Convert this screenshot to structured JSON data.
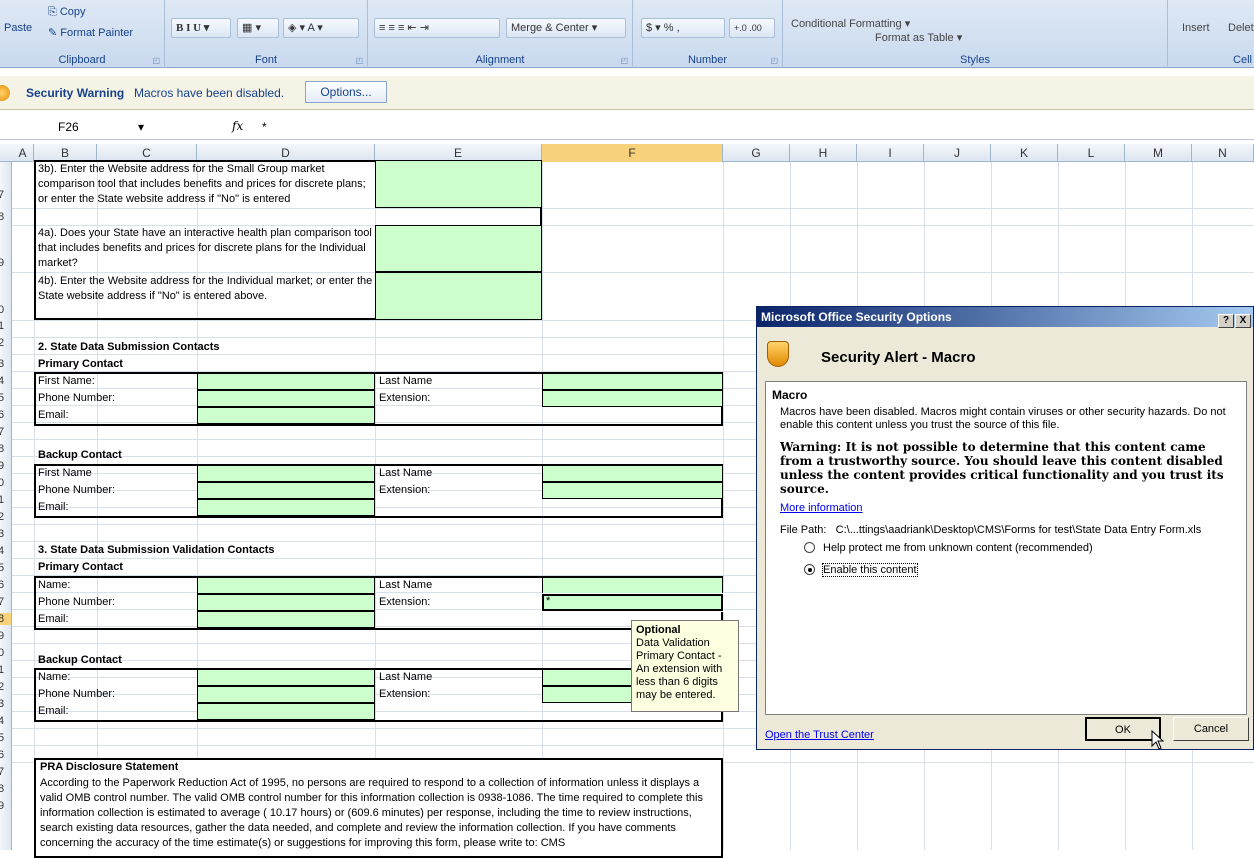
{
  "ribbon": {
    "clipboard": {
      "paste": "Paste",
      "copy": "Copy",
      "format_painter": "Format Painter",
      "label": "Clipboard"
    },
    "font_label": "Font",
    "alignment": {
      "merge_center": "Merge & Center",
      "label": "Alignment"
    },
    "number": {
      "label": "Number",
      "currency": "$",
      "percent": "%",
      "comma": ","
    },
    "styles": {
      "conditional": "Conditional Formatting",
      "format_table": "Format as Table",
      "label": "Styles"
    },
    "cells": {
      "insert": "Insert",
      "delete": "Delet",
      "label": "Cell"
    }
  },
  "security_bar": {
    "title": "Security Warning",
    "message": "Macros have been disabled.",
    "options": "Options..."
  },
  "formula_bar": {
    "name_box": "F26",
    "fx": "fx",
    "value": "*"
  },
  "columns": [
    "A",
    "B",
    "C",
    "D",
    "E",
    "F",
    "G",
    "H",
    "I",
    "J",
    "K",
    "L",
    "M",
    "N"
  ],
  "row_numbers": [
    "7",
    "8",
    "9",
    "0",
    "1",
    "2",
    "3",
    "4",
    "5",
    "6",
    "7",
    "8",
    "9",
    "0",
    "1",
    "2",
    "3",
    "4",
    "5",
    "6",
    "7",
    "8",
    "9",
    "0",
    "1",
    "2",
    "3",
    "4",
    "5",
    "6",
    "7",
    "8",
    "9"
  ],
  "sheet": {
    "q3b": "3b). Enter the Website address for the Small Group market comparison tool that includes benefits and prices for discrete plans; or enter the State website address if \"No\" is entered",
    "q4a": "4a). Does your State have an interactive health plan comparison tool that includes benefits and prices for discrete plans for the Individual market?",
    "q4b": "4b). Enter the Website address for the Individual market; or enter the State website address if \"No\" is entered above.",
    "sec2": "2. State Data Submission Contacts",
    "primary": "Primary Contact",
    "backup": "Backup Contact",
    "first_name_colon": "First Name:",
    "first_name": "First Name",
    "last_name": "Last Name",
    "phone": "Phone Number:",
    "extension": "Extension:",
    "email": "Email:",
    "sec3": "3. State Data Submission Validation Contacts",
    "name": "Name:",
    "active_value": "*",
    "pra_title": "PRA Disclosure Statement",
    "pra_text": "According to the Paperwork Reduction Act of 1995, no persons are required to respond to a collection of information unless it displays a valid OMB control number. The valid OMB control number for this information collection is 0938-1086. The time required to complete this information collection is estimated to average ( 10.17 hours) or (609.6 minutes) per response, including the time to review instructions, search existing data resources, gather the data needed, and complete and review the information collection. If you have comments concerning the accuracy of the time estimate(s) or suggestions for improving this form, please write to: CMS"
  },
  "tooltip": {
    "title": "Optional",
    "text": "Data Validation Primary Contact - An extension with less than 6 digits may be entered."
  },
  "dialog": {
    "title": "Microsoft Office Security Options",
    "help": "?",
    "close": "X",
    "heading": "Security Alert - Macro",
    "section": "Macro",
    "message": "Macros have been disabled. Macros might contain viruses or other security hazards. Do not enable this content unless you trust the source of this file.",
    "warning": "Warning: It is not possible to determine that this content came from a trustworthy source. You should leave this content disabled unless the content provides critical functionality and you trust its source.",
    "more_info": "More information",
    "file_path_label": "File Path:",
    "file_path": "C:\\...ttings\\aadriank\\Desktop\\CMS\\Forms for test\\State Data Entry Form.xls",
    "opt_protect": "Help protect me from unknown content (recommended)",
    "opt_enable": "Enable this content",
    "trust_center": "Open the Trust Center",
    "ok": "OK",
    "cancel": "Cancel"
  }
}
